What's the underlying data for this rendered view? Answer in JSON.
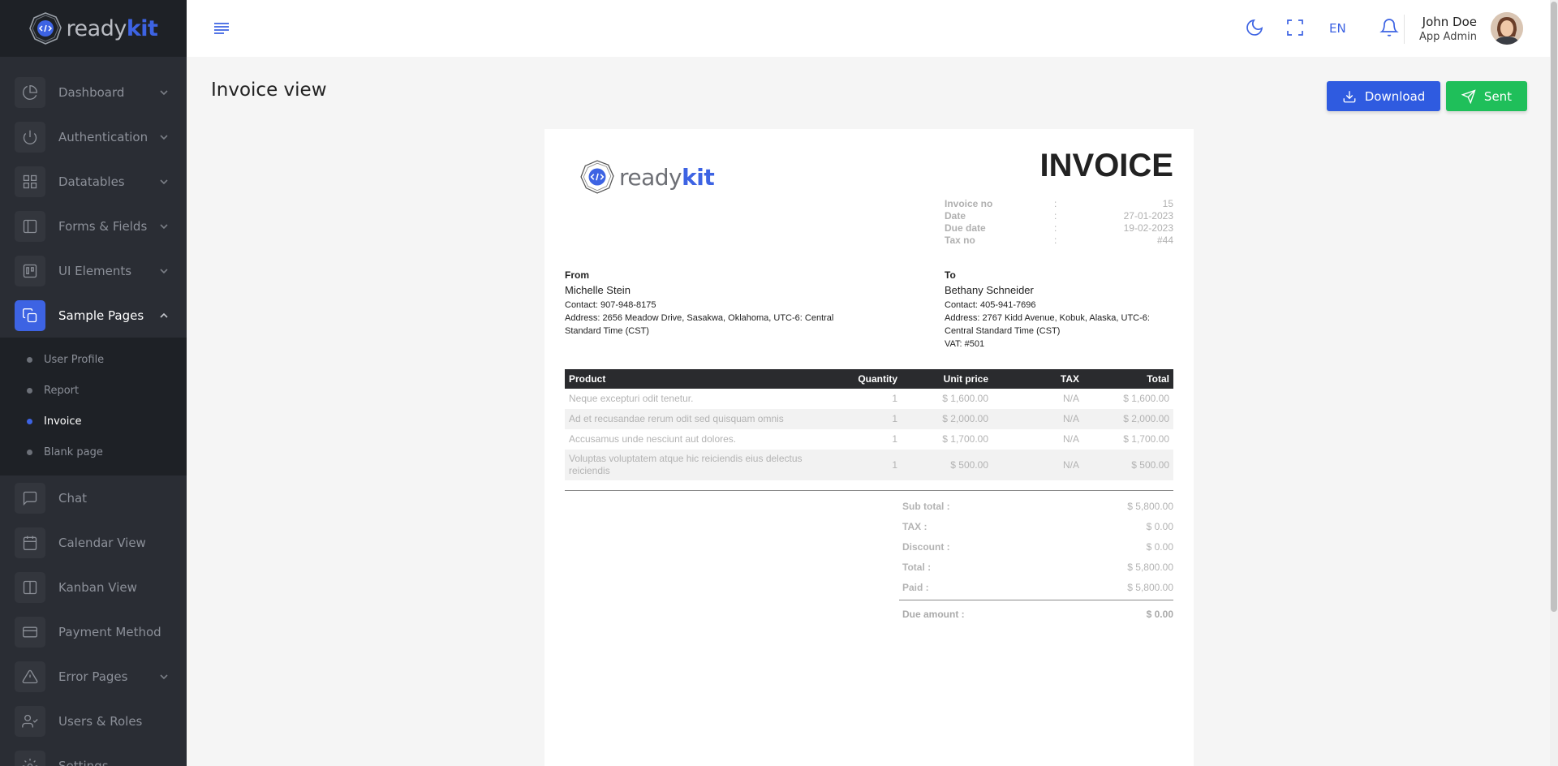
{
  "brand": {
    "ready": "ready",
    "kit": "kit"
  },
  "sidebar": {
    "items": [
      {
        "label": "Dashboard",
        "icon": "pie-chart-icon",
        "has_children": true
      },
      {
        "label": "Authentication",
        "icon": "power-icon",
        "has_children": true
      },
      {
        "label": "Datatables",
        "icon": "grid-icon",
        "has_children": true
      },
      {
        "label": "Forms & Fields",
        "icon": "layout-sidebar-icon",
        "has_children": true
      },
      {
        "label": "UI Elements",
        "icon": "trello-icon",
        "has_children": true
      },
      {
        "label": "Sample Pages",
        "icon": "copy-icon",
        "has_children": true,
        "expanded": true,
        "active": true
      },
      {
        "label": "Chat",
        "icon": "message-square-icon",
        "has_children": false
      },
      {
        "label": "Calendar View",
        "icon": "calendar-icon",
        "has_children": false
      },
      {
        "label": "Kanban View",
        "icon": "columns-icon",
        "has_children": false
      },
      {
        "label": "Payment Method",
        "icon": "credit-card-icon",
        "has_children": false
      },
      {
        "label": "Error Pages",
        "icon": "alert-triangle-icon",
        "has_children": true
      },
      {
        "label": "Users & Roles",
        "icon": "user-check-icon",
        "has_children": false
      },
      {
        "label": "Settings",
        "icon": "settings-icon",
        "has_children": false
      }
    ],
    "submenu": [
      {
        "label": "User Profile",
        "active": false
      },
      {
        "label": "Report",
        "active": false
      },
      {
        "label": "Invoice",
        "active": true
      },
      {
        "label": "Blank page",
        "active": false
      }
    ]
  },
  "topbar": {
    "language": "EN",
    "user": {
      "name": "John Doe",
      "role": "App Admin"
    }
  },
  "page": {
    "title": "Invoice view",
    "download_label": "Download",
    "sent_label": "Sent"
  },
  "invoice": {
    "title": "INVOICE",
    "meta": [
      {
        "label": "Invoice no",
        "sep": ":",
        "value": "15"
      },
      {
        "label": "Date",
        "sep": ":",
        "value": "27-01-2023"
      },
      {
        "label": "Due date",
        "sep": ":",
        "value": "19-02-2023"
      },
      {
        "label": "Tax no",
        "sep": ":",
        "value": "#44"
      }
    ],
    "from": {
      "heading": "From",
      "name": "Michelle Stein",
      "contact": "Contact: 907-948-8175",
      "address": "Address: 2656 Meadow Drive, Sasakwa, Oklahoma, UTC-6: Central Standard Time (CST)"
    },
    "to": {
      "heading": "To",
      "name": "Bethany Schneider",
      "contact": "Contact: 405-941-7696",
      "address": "Address: 2767 Kidd Avenue, Kobuk, Alaska, UTC-6: Central Standard Time (CST)",
      "vat": "VAT: #501"
    },
    "columns": [
      "Product",
      "Quantity",
      "Unit price",
      "TAX",
      "Total"
    ],
    "rows": [
      {
        "product": "Neque excepturi odit tenetur.",
        "quantity": "1",
        "unit_price": "$ 1,600.00",
        "tax": "N/A",
        "total": "$ 1,600.00"
      },
      {
        "product": "Ad et recusandae rerum odit sed quisquam omnis",
        "quantity": "1",
        "unit_price": "$ 2,000.00",
        "tax": "N/A",
        "total": "$ 2,000.00"
      },
      {
        "product": "Accusamus unde nesciunt aut dolores.",
        "quantity": "1",
        "unit_price": "$ 1,700.00",
        "tax": "N/A",
        "total": "$ 1,700.00"
      },
      {
        "product": "Voluptas voluptatem atque hic reiciendis eius delectus reiciendis",
        "quantity": "1",
        "unit_price": "$ 500.00",
        "tax": "N/A",
        "total": "$ 500.00"
      }
    ],
    "totals": [
      {
        "label": "Sub total :",
        "value": "$ 5,800.00"
      },
      {
        "label": "TAX :",
        "value": "$ 0.00"
      },
      {
        "label": "Discount :",
        "value": "$ 0.00"
      },
      {
        "label": "Total :",
        "value": "$ 5,800.00"
      },
      {
        "label": "Paid :",
        "value": "$ 5,800.00"
      }
    ],
    "due": {
      "label": "Due amount :",
      "value": "$ 0.00"
    }
  },
  "colors": {
    "accent": "#3d63e3",
    "download_button": "#2f5be0",
    "sent_button": "#1fbf5a",
    "sidebar_bg": "#2a2d34",
    "table_header_bg": "#2a2b2e"
  }
}
